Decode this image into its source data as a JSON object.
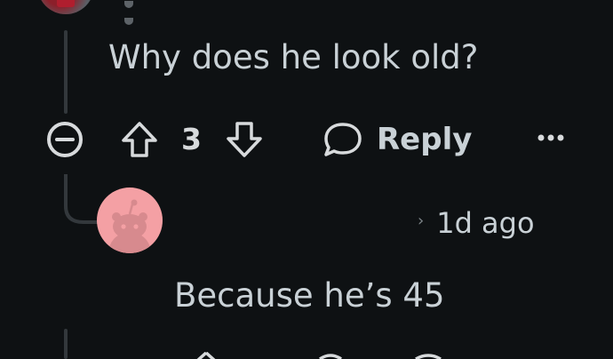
{
  "parent_comment": {
    "text": "Why does he look old?",
    "vote_count": "3",
    "reply_label": "Reply"
  },
  "child_comment": {
    "timestamp": "1d ago",
    "separator": "›",
    "text": "Because he’s 45"
  },
  "icons": {
    "collapse": "collapse-minus-icon",
    "upvote": "arrow-up-icon",
    "downvote": "arrow-down-icon",
    "reply": "speech-bubble-icon",
    "more": "more-dots-icon"
  },
  "colors": {
    "background": "#0e1113",
    "text": "#c9d1d6",
    "thread_line": "#33383c",
    "default_avatar": "#f4a0a4"
  }
}
